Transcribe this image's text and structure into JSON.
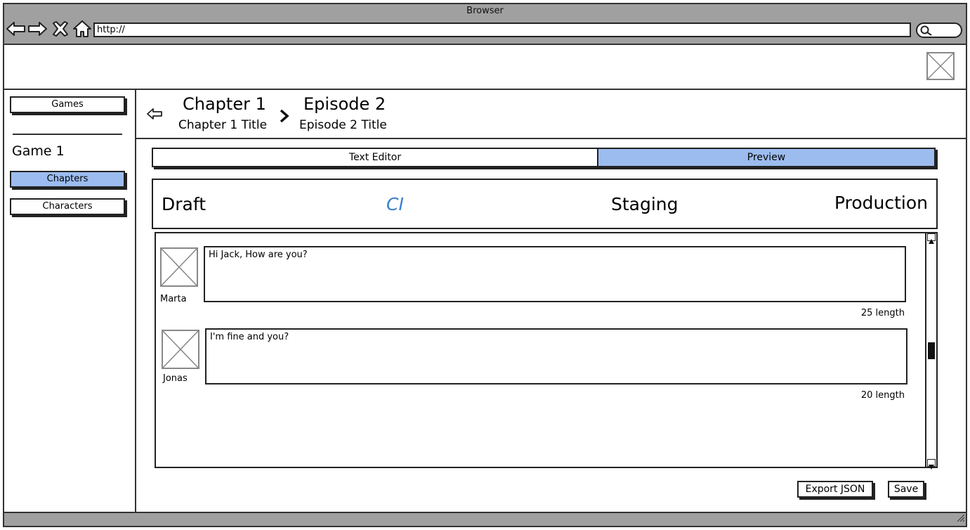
{
  "browser": {
    "title": "Browser",
    "url": "http://",
    "nav_icons": [
      "back-arrow-icon",
      "forward-arrow-icon",
      "close-x-icon",
      "home-icon"
    ],
    "search_icon": "search-icon"
  },
  "sidebar": {
    "games_label": "Games",
    "game_title": "Game 1",
    "items": [
      {
        "label": "Chapters",
        "active": true
      },
      {
        "label": "Characters",
        "active": false
      }
    ]
  },
  "breadcrumb": {
    "back_icon": "back-arrow-icon",
    "separator_icon": "chevron-right-icon",
    "chapter": {
      "title": "Chapter 1",
      "subtitle": "Chapter 1 Title"
    },
    "episode": {
      "title": "Episode 2",
      "subtitle": "Episode 2 Title"
    }
  },
  "tabs": [
    {
      "label": "Text Editor",
      "active": false
    },
    {
      "label": "Preview",
      "active": true
    }
  ],
  "stages": [
    "Draft",
    "CI",
    "Staging",
    "Production"
  ],
  "messages": [
    {
      "character": "Marta",
      "text": "Hi Jack, How are you?",
      "length": "25 length"
    },
    {
      "character": "Jonas",
      "text": "I'm fine and you?",
      "length": "20 length"
    }
  ],
  "actions": {
    "export_label": "Export JSON",
    "save_label": "Save"
  },
  "colors": {
    "accent": "#9cbcef",
    "ci_stage": "#3a82d0",
    "chrome": "#a0a0a0"
  }
}
